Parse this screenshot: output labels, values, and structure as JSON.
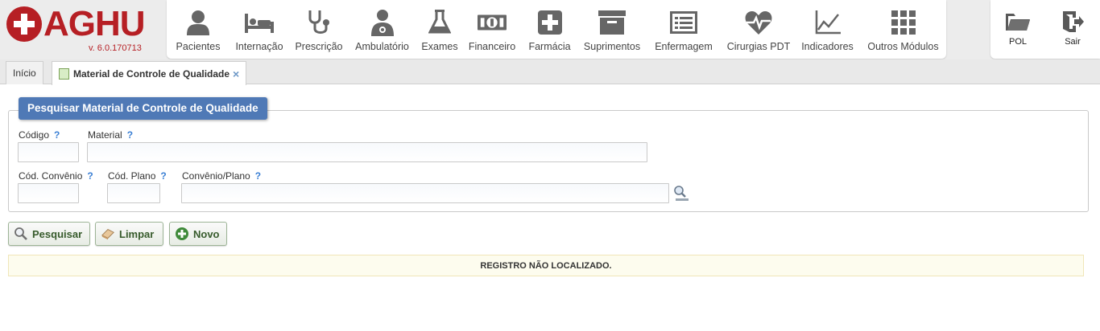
{
  "app": {
    "name": "AGHU",
    "version": "v. 6.0.170713"
  },
  "modules": [
    {
      "label": "Pacientes",
      "icon": "user-icon"
    },
    {
      "label": "Internação",
      "icon": "bed-icon"
    },
    {
      "label": "Prescrição",
      "icon": "stethoscope-icon"
    },
    {
      "label": "Ambulatório",
      "icon": "doctor-icon"
    },
    {
      "label": "Exames",
      "icon": "flask-icon"
    },
    {
      "label": "Financeiro",
      "icon": "money-icon"
    },
    {
      "label": "Farmácia",
      "icon": "plus-box-icon"
    },
    {
      "label": "Suprimentos",
      "icon": "archive-box-icon"
    },
    {
      "label": "Enfermagem",
      "icon": "list-panel-icon"
    },
    {
      "label": "Cirurgias PDT",
      "icon": "heartbeat-icon"
    },
    {
      "label": "Indicadores",
      "icon": "line-chart-icon"
    },
    {
      "label": "Outros Módulos",
      "icon": "grid-icon"
    }
  ],
  "tools": {
    "pol": {
      "label": "POL",
      "icon": "folder-icon"
    },
    "sair": {
      "label": "Sair",
      "icon": "exit-icon"
    }
  },
  "tabs": {
    "inicio": "Início",
    "active": "Material de Controle de Qualidade",
    "close": "×"
  },
  "form": {
    "title": "Pesquisar Material de Controle de Qualidade",
    "help_mark": "?",
    "fields": {
      "codigo": {
        "label": "Código",
        "value": ""
      },
      "material": {
        "label": "Material",
        "value": ""
      },
      "cod_convenio": {
        "label": "Cód. Convênio",
        "value": ""
      },
      "cod_plano": {
        "label": "Cód. Plano",
        "value": ""
      },
      "convenio_plano": {
        "label": "Convênio/Plano",
        "value": ""
      }
    }
  },
  "buttons": {
    "pesquisar": "Pesquisar",
    "limpar": "Limpar",
    "novo": "Novo"
  },
  "message": "REGISTRO NÃO LOCALIZADO.",
  "colors": {
    "brand": "#b61f24",
    "legend": "#4f79b6",
    "button_text": "#375b2c",
    "help": "#3a7fd4"
  }
}
